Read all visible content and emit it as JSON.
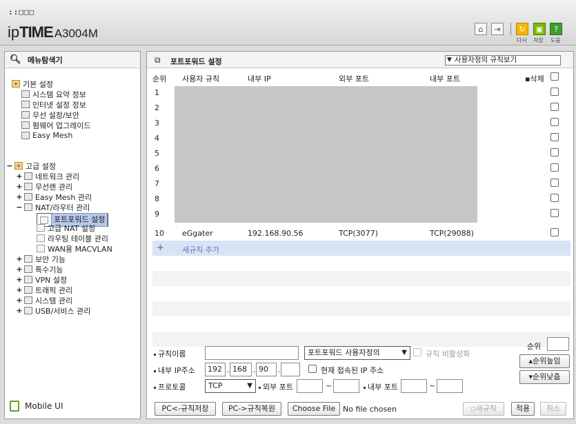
{
  "header": {
    "dots": "::□□□",
    "brand_a": "ip",
    "brand_b": "TIME",
    "brand_c": "A3004M",
    "buttons": [
      {
        "icon": "home-icon"
      },
      {
        "icon": "logout-icon"
      },
      {
        "icon": "refresh-icon",
        "label": "다시"
      },
      {
        "icon": "save-icon",
        "label": "저장"
      },
      {
        "icon": "help-icon",
        "label": "도움"
      }
    ]
  },
  "sidebar": {
    "title": "메뉴탐색기",
    "mobile": "Mobile UI",
    "basic": {
      "label": "기본 설정",
      "items": [
        "시스템 요약 정보",
        "인터넷 설정 정보",
        "무선 설정/보안",
        "펌웨어 업그레이드",
        "Easy Mesh"
      ]
    },
    "advanced": {
      "label": "고급 설정",
      "items": [
        "네트워크 관리",
        "무선랜 관리",
        "Easy Mesh 관리",
        "NAT/라우터 관리"
      ],
      "nat_children": [
        "포트포워드 설정",
        "고급 NAT 설정",
        "라우팅 테이블 관리",
        "WAN용 MACVLAN"
      ],
      "after": [
        "보안 기능",
        "특수기능",
        "VPN 설정",
        "트래픽 관리",
        "시스템 관리",
        "USB/서비스 관리"
      ]
    }
  },
  "main": {
    "title": "포트포워드 설정",
    "view_select": "사용자정의 규칙보기",
    "columns": [
      "순위",
      "사용자 규칙",
      "내부 IP",
      "외부 포트",
      "내부 포트",
      "삭제"
    ],
    "rows": [
      {
        "no": "1"
      },
      {
        "no": "2"
      },
      {
        "no": "3"
      },
      {
        "no": "4"
      },
      {
        "no": "5"
      },
      {
        "no": "6"
      },
      {
        "no": "7"
      },
      {
        "no": "8"
      },
      {
        "no": "9"
      },
      {
        "no": "10",
        "rule": "eGgater",
        "ip": "192.168.90.56",
        "ext": "TCP(3077)",
        "int": "TCP(29088)"
      }
    ],
    "add_rule": "새규칙 추가",
    "form": {
      "rule_name_label": "규칙이름",
      "rule_name_value": "",
      "type_select": "포트포워드 사용자정의",
      "disable_label": "규칙 비활성화",
      "ip_label": "내부 IP주소",
      "ip": [
        "192",
        "168",
        "90",
        ""
      ],
      "current_ip_label": "현재 접속된 IP 주소",
      "proto_label": "프로토콜",
      "proto_value": "TCP",
      "ext_port_label": "외부 포트",
      "int_port_label": "내부 포트",
      "tilde": "~",
      "rank_label": "순위",
      "rank_up": "순위높임",
      "rank_down": "순위낮춤",
      "save_rules": "PC<-규칙저장",
      "restore_rules": "PC->규칙복원",
      "choose_file": "Choose File",
      "no_file": "No file chosen",
      "new_rule": "새규칙",
      "apply": "적용",
      "cancel": "취소"
    }
  }
}
